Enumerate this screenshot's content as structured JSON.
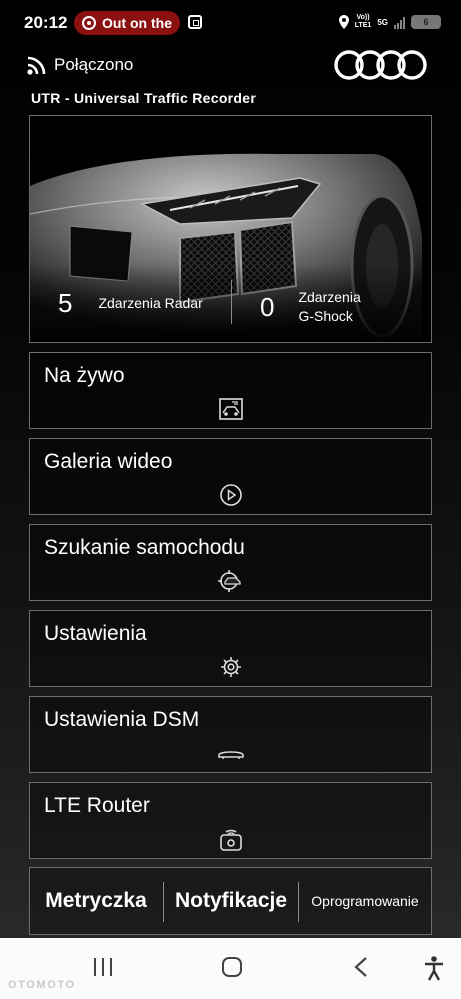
{
  "status_bar": {
    "time": "20:12",
    "pill_text": "Out on the",
    "volte_top": "Vo))",
    "volte_bottom": "LTE1",
    "network": "5G",
    "battery": "6"
  },
  "header": {
    "connection_label": "Połączono",
    "app_title": "UTR - Universal Traffic Recorder"
  },
  "hero": {
    "radar_count": "5",
    "radar_label": "Zdarzenia Radar",
    "gshock_count": "0",
    "gshock_label_line1": "Zdarzenia",
    "gshock_label_line2": "G-Shock"
  },
  "menu": [
    {
      "label": "Na żywo",
      "icon": "live-view-icon"
    },
    {
      "label": "Galeria wideo",
      "icon": "play-icon"
    },
    {
      "label": "Szukanie samochodu",
      "icon": "car-search-icon"
    },
    {
      "label": "Ustawienia",
      "icon": "gear-icon"
    },
    {
      "label": "Ustawienia DSM",
      "icon": "dsm-device-icon"
    },
    {
      "label": "LTE Router",
      "icon": "router-icon"
    }
  ],
  "tabs": {
    "metryczka": "Metryczka",
    "notyfikacje": "Notyfikacje",
    "oprogramowanie": "Oprogramowanie"
  },
  "navbar": {
    "icons": [
      "recent-apps-icon",
      "home-icon",
      "back-icon",
      "accessibility-icon"
    ]
  },
  "watermark": "OTOMOTO",
  "colors": {
    "pill_red": "#8b1111",
    "card_border": "#6e6e6e",
    "nav_bg": "#fbfbfb"
  }
}
